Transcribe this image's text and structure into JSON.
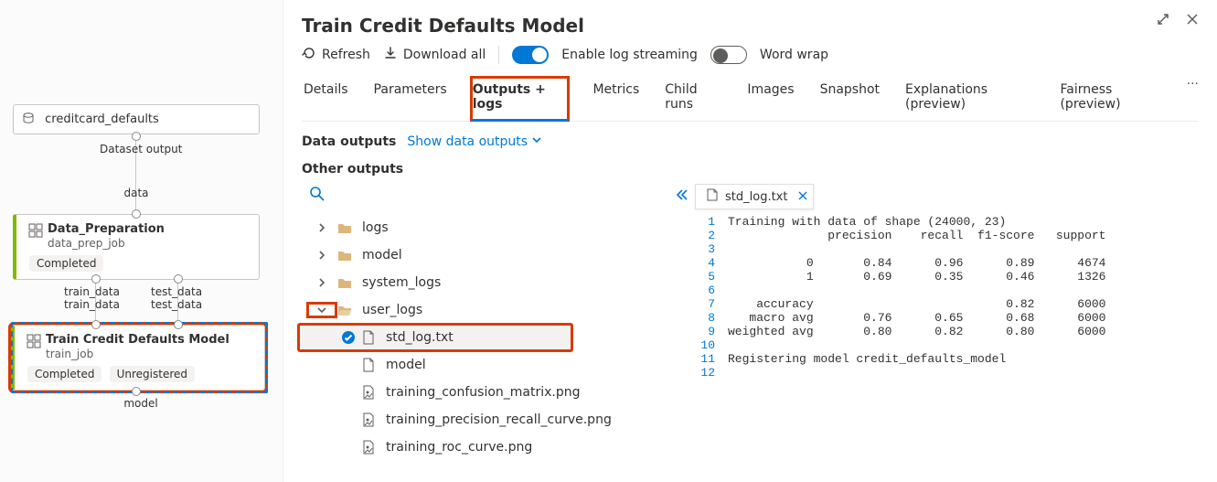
{
  "pipeline": {
    "dataset": {
      "name": "creditcard_defaults",
      "out_label": "Dataset output"
    },
    "edge1": "data",
    "prep": {
      "title": "Data_Preparation",
      "subtitle": "data_prep_job",
      "status": "Completed"
    },
    "edge2a": "train_data\ntrain_data",
    "edge2b": "test_data\ntest_data",
    "train": {
      "title": "Train Credit Defaults Model",
      "subtitle": "train_job",
      "status": "Completed",
      "reg": "Unregistered"
    },
    "edge3": "model"
  },
  "header": {
    "title": "Train Credit Defaults Model",
    "refresh": "Refresh",
    "download_all": "Download all",
    "log_stream": "Enable log streaming",
    "word_wrap": "Word wrap"
  },
  "tabs": [
    "Details",
    "Parameters",
    "Outputs + logs",
    "Metrics",
    "Child runs",
    "Images",
    "Snapshot",
    "Explanations (preview)",
    "Fairness (preview)"
  ],
  "active_tab": 2,
  "data_outputs": {
    "label": "Data outputs",
    "link": "Show data outputs"
  },
  "other_outputs_label": "Other outputs",
  "tree": {
    "folders": [
      "logs",
      "model",
      "system_logs",
      "user_logs"
    ],
    "user_logs_files": [
      "std_log.txt",
      "model",
      "training_confusion_matrix.png",
      "training_precision_recall_curve.png",
      "training_roc_curve.png"
    ]
  },
  "viewer": {
    "tab": "std_log.txt",
    "lines": [
      "Training with data of shape (24000, 23)",
      "              precision    recall  f1-score   support",
      "",
      "           0       0.84      0.96      0.89      4674",
      "           1       0.69      0.35      0.46      1326",
      "",
      "    accuracy                           0.82      6000",
      "   macro avg       0.76      0.65      0.68      6000",
      "weighted avg       0.80      0.82      0.80      6000",
      "",
      "Registering model credit_defaults_model",
      ""
    ]
  },
  "chart_data": {
    "type": "table",
    "title": "Classification report (std_log.txt)",
    "data_shape": [
      24000,
      23
    ],
    "columns": [
      "precision",
      "recall",
      "f1-score",
      "support"
    ],
    "rows": {
      "0": [
        0.84,
        0.96,
        0.89,
        4674
      ],
      "1": [
        0.69,
        0.35,
        0.46,
        1326
      ],
      "accuracy": [
        null,
        null,
        0.82,
        6000
      ],
      "macro avg": [
        0.76,
        0.65,
        0.68,
        6000
      ],
      "weighted avg": [
        0.8,
        0.82,
        0.8,
        6000
      ]
    },
    "registered_model": "credit_defaults_model"
  }
}
